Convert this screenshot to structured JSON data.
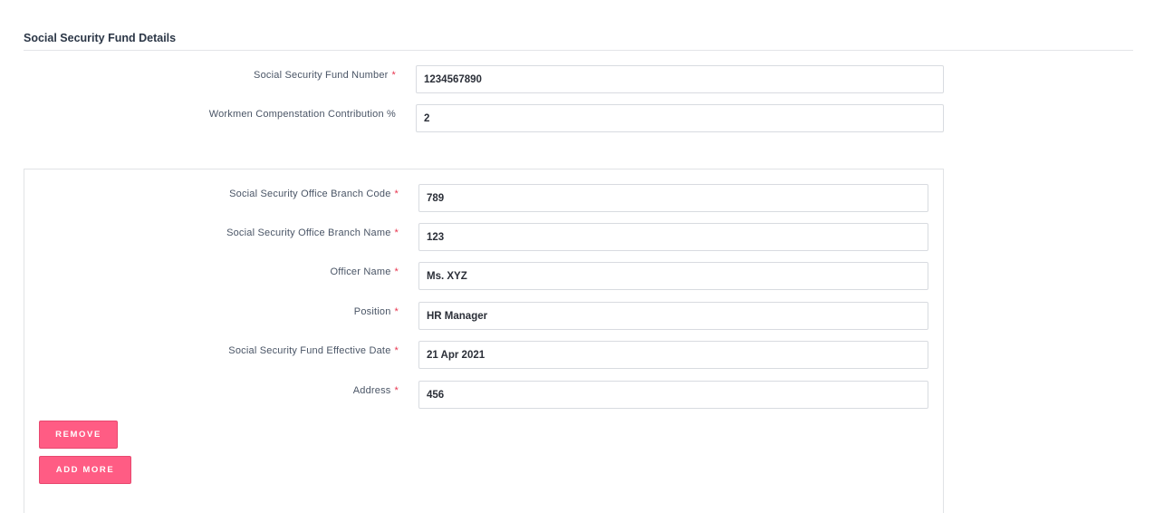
{
  "section": {
    "title": "Social Security Fund Details"
  },
  "top_fields": [
    {
      "label": "Social Security Fund Number",
      "required": true,
      "value": "1234567890"
    },
    {
      "label": "Workmen Compenstation Contribution %",
      "required": false,
      "value": "2"
    }
  ],
  "branch_fields": [
    {
      "label": "Social Security Office Branch Code",
      "required": true,
      "value": "789"
    },
    {
      "label": "Social Security Office Branch Name",
      "required": true,
      "value": "123"
    },
    {
      "label": "Officer Name",
      "required": true,
      "value": "Ms. XYZ"
    },
    {
      "label": "Position",
      "required": true,
      "value": "HR Manager"
    },
    {
      "label": "Social Security Fund Effective Date",
      "required": true,
      "value": "21 Apr 2021"
    },
    {
      "label": "Address",
      "required": true,
      "value": "456"
    }
  ],
  "required_marker": "*",
  "buttons": {
    "remove": "REMOVE",
    "add_more": "ADD MORE"
  },
  "colors": {
    "accent": "#ff5c84",
    "required": "#e8364f"
  }
}
